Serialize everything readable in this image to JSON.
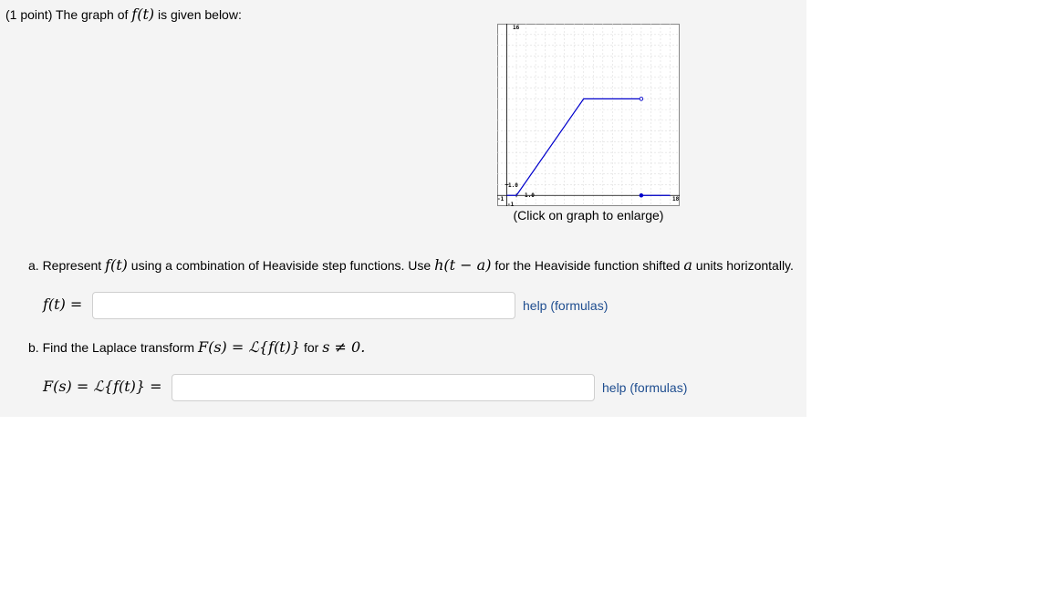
{
  "intro": {
    "prefix": "(1 point) The graph of ",
    "func": "f(t)",
    "suffix": " is given below:"
  },
  "graph": {
    "caption": "(Click on graph to enlarge)",
    "tick_labels": {
      "ymax": "16",
      "ymin": "-1",
      "xmin": "-1",
      "xmax": "18",
      "y_one": "1.0",
      "x_one": "1.0"
    },
    "line_color": "#0000cc"
  },
  "chart_data": {
    "type": "line",
    "xlim": [
      -1,
      18
    ],
    "ylim": [
      -1,
      16
    ],
    "grid": true,
    "series": [
      {
        "points": [
          [
            0,
            0
          ],
          [
            1,
            0
          ]
        ]
      },
      {
        "points": [
          [
            1,
            0
          ],
          [
            8,
            9
          ],
          [
            14,
            9
          ]
        ],
        "end_open": true
      },
      {
        "points": [
          [
            14,
            0
          ],
          [
            17,
            0
          ]
        ],
        "start_closed": true
      }
    ]
  },
  "part_a": {
    "prefix": "a. Represent ",
    "func": "f(t)",
    "mid": " using a combination of Heaviside step functions. Use ",
    "heaviside": "h(t − a)",
    "mid2": " for the Heaviside function shifted ",
    "var_a": "a",
    "suffix": " units horizontally.",
    "label": "f(t) =",
    "input_value": "",
    "help": "help (formulas)"
  },
  "part_b": {
    "prefix": "b. Find the Laplace transform ",
    "formula": "F(s) = ℒ{f(t)}",
    "mid": " for ",
    "cond": "s ≠ 0.",
    "label": "F(s) = ℒ{f(t)} =",
    "input_value": "",
    "help": "help (formulas)"
  }
}
